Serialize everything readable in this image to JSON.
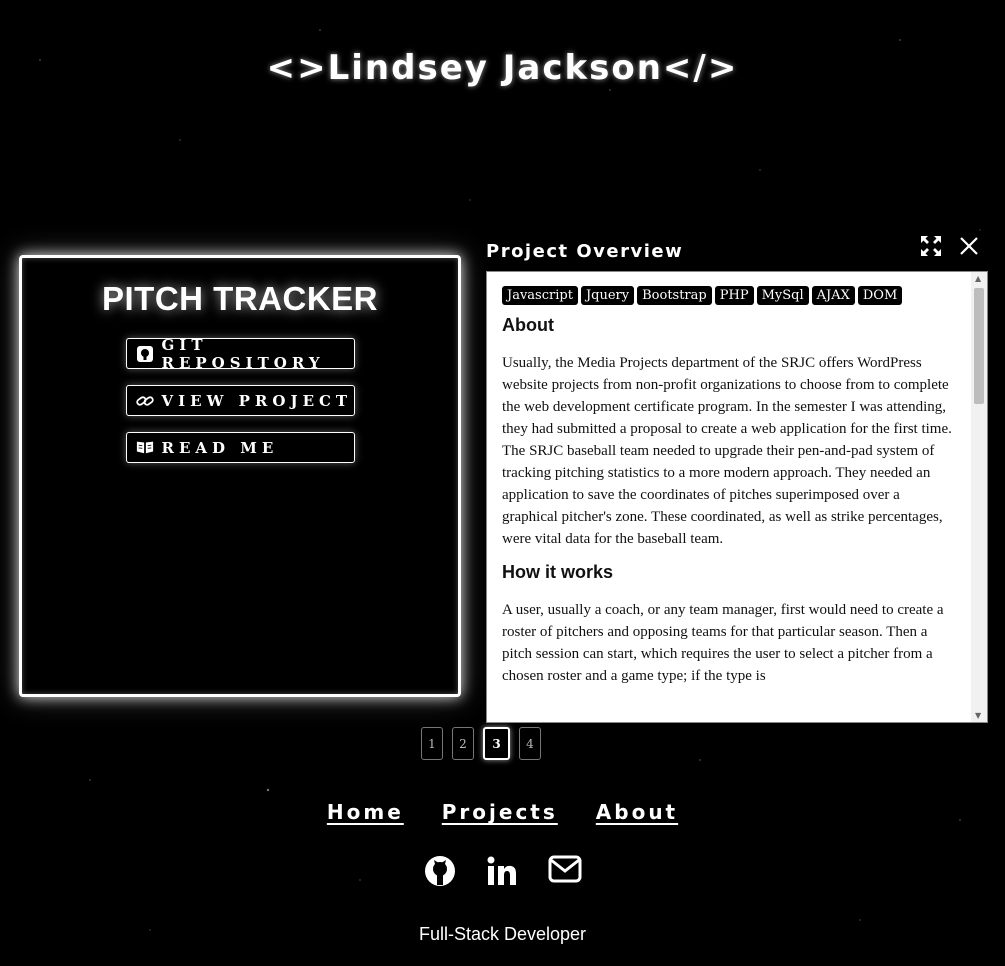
{
  "site": {
    "title": "<>Lindsey Jackson</>",
    "tagline": "Full-Stack Developer"
  },
  "project": {
    "name": "PITCH TRACKER",
    "buttons": [
      {
        "label": "GIT REPOSITORY",
        "icon": "github-square-icon"
      },
      {
        "label": "VIEW PROJECT",
        "icon": "link-icon"
      },
      {
        "label": "READ ME",
        "icon": "book-open-icon"
      }
    ]
  },
  "overview": {
    "title": "Project Overview",
    "tags": [
      "Javascript",
      "Jquery",
      "Bootstrap",
      "PHP",
      "MySql",
      "AJAX",
      "DOM"
    ],
    "about_heading": "About",
    "about_text": "Usually, the Media Projects department of the SRJC offers WordPress website projects from non-profit organizations to choose from to complete the web development certificate program. In the semester I was attending, they had submitted a proposal to create a web application for the first time. The SRJC baseball team needed to upgrade their pen-and-pad system of tracking pitching statistics to a more modern approach. They needed an application to save the coordinates of pitches superimposed over a graphical pitcher's zone. These coordinated, as well as strike percentages, were vital data for the baseball team.",
    "how_heading": "How it works",
    "how_text": "A user, usually a coach, or any team manager, first would need to create a roster of pitchers and opposing teams for that particular season. Then a pitch session can start, which requires the user to select a pitcher from a chosen roster and a game type; if the type is"
  },
  "pagination": {
    "pages": [
      "1",
      "2",
      "3",
      "4"
    ],
    "current": "3"
  },
  "nav": {
    "home": "Home",
    "projects": "Projects",
    "about": "About"
  },
  "socials": [
    "github-icon",
    "linkedin-icon",
    "envelope-icon"
  ]
}
